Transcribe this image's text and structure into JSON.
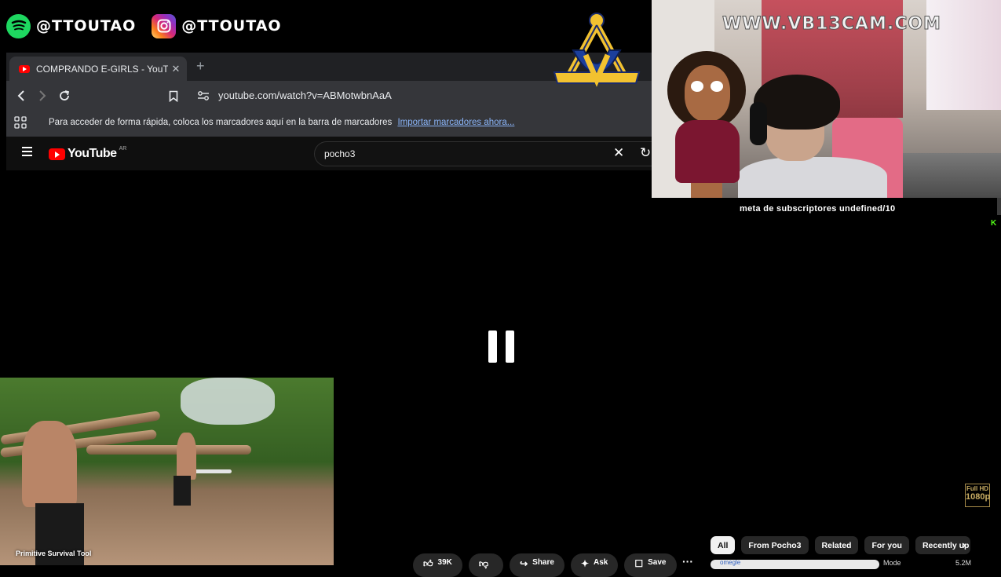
{
  "social": [
    {
      "icon": "spotify-icon",
      "handle": "@TTOUTAO"
    },
    {
      "icon": "instagram-icon",
      "handle": "@TTOUTAO"
    }
  ],
  "browser": {
    "tab_title": "COMPRANDO E-GIRLS - YouTube",
    "tab_close": "✕",
    "new_tab": "+",
    "url": "youtube.com/watch?v=ABMotwbnAaA",
    "bookmark_message": "Para acceder de forma rápida, coloca los marcadores aquí en la barra de marcadores",
    "bookmark_link": "Importar marcadores ahora..."
  },
  "youtube": {
    "logo_text": "YouTube",
    "region": "AR",
    "search_query": "pocho3",
    "clear_glyph": "✕",
    "reload_glyph": "↻"
  },
  "overlay": {
    "watermark": "WWW.VB13CAM.COM",
    "subscriber_goal": "meta de subscriptores undefined/10",
    "kick_mark": "K",
    "thumbnail_caption": "Primitive Survival Tool",
    "hd_line1": "Full HD",
    "hd_line2": "1080p"
  },
  "chips": [
    {
      "label": "All",
      "active": true
    },
    {
      "label": "From Pocho3",
      "active": false
    },
    {
      "label": "Related",
      "active": false
    },
    {
      "label": "For you",
      "active": false
    },
    {
      "label": "Recently up",
      "active": false
    }
  ],
  "chips_next": "›",
  "actions": {
    "like_count": "39K",
    "share": "Share",
    "ask": "Ask",
    "save": "Save",
    "more": "···"
  },
  "bottom": {
    "tag": "omegle",
    "misc1": "Mode",
    "misc2": "5.2M"
  },
  "colors": {
    "background": "#000000",
    "chrome_dark": "#202124",
    "chrome_toolbar": "#35363a",
    "yt_red": "#ff0000",
    "link_blue": "#8ab4f8",
    "spotify_green": "#1ed760",
    "kick_green": "#53fc18"
  }
}
